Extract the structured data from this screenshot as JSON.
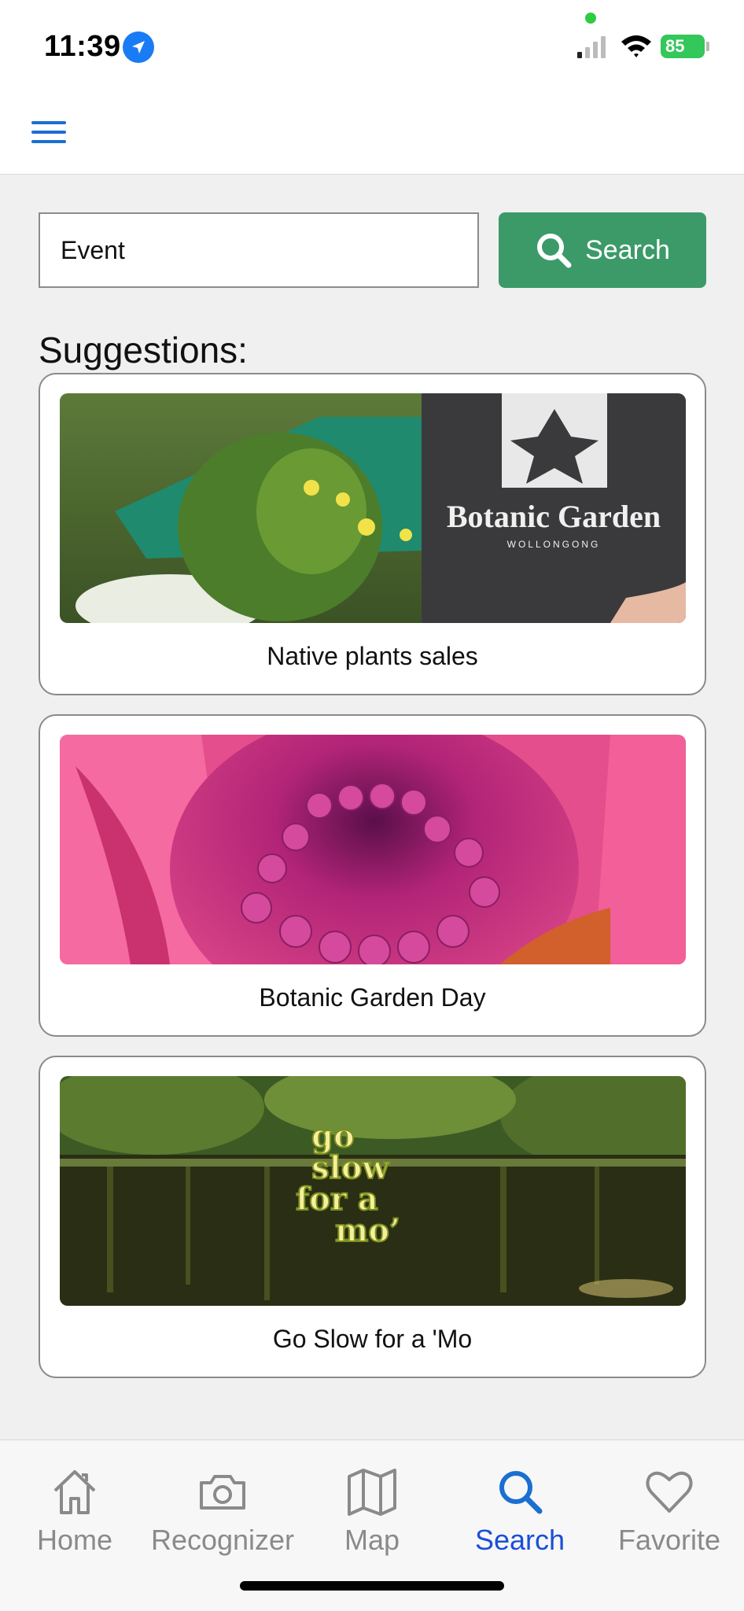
{
  "status": {
    "time": "11:39",
    "battery": "85"
  },
  "header": {
    "menu_icon": "hamburger-menu-icon"
  },
  "search": {
    "value": "Event",
    "placeholder": "",
    "button_label": "Search"
  },
  "suggestions": {
    "title": "Suggestions:",
    "items": [
      {
        "label": "Native plants sales",
        "image_text": "Botanic Garden",
        "image_subtext": "WOLLONGONG"
      },
      {
        "label": "Botanic Garden Day"
      },
      {
        "label": "Go Slow for a 'Mo",
        "image_text": "go slow for a mo'"
      }
    ]
  },
  "tabs": [
    {
      "label": "Home",
      "icon": "home-icon",
      "active": false
    },
    {
      "label": "Recognizer",
      "icon": "camera-icon",
      "active": false
    },
    {
      "label": "Map",
      "icon": "map-icon",
      "active": false
    },
    {
      "label": "Search",
      "icon": "search-icon",
      "active": true
    },
    {
      "label": "Favorite",
      "icon": "heart-icon",
      "active": false
    }
  ],
  "colors": {
    "accent_green": "#3c9a68",
    "active_tab": "#1a4fd6",
    "menu_blue": "#1a6fd1"
  }
}
